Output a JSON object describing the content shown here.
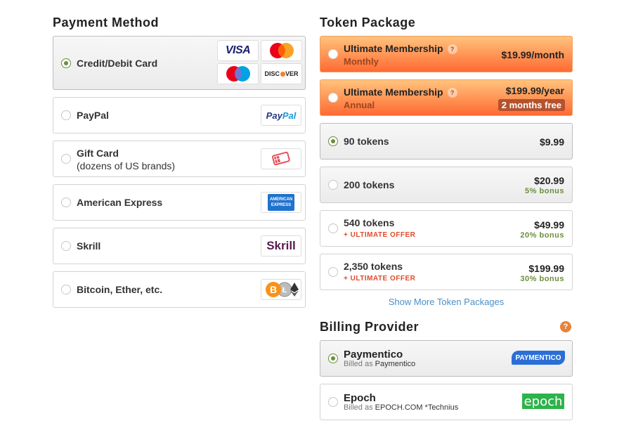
{
  "payment_method": {
    "title": "Payment Method",
    "options": [
      {
        "label": "Credit/Debit Card",
        "selected": true,
        "logos": [
          "visa-logo",
          "mastercard-logo",
          "maestro-logo",
          "discover-logo"
        ]
      },
      {
        "label": "PayPal",
        "selected": false,
        "logo_text": "PayPal"
      },
      {
        "label": "Gift Card",
        "sublabel": "(dozens of US brands)",
        "selected": false,
        "logo": "gift-card-icon"
      },
      {
        "label": "American Express",
        "selected": false,
        "logo_lines": [
          "AMERICAN",
          "EXPRESS"
        ]
      },
      {
        "label": "Skrill",
        "selected": false,
        "logo_text": "Skrill"
      },
      {
        "label": "Bitcoin, Ether, etc.",
        "selected": false,
        "logo": "crypto-icons"
      }
    ],
    "logo_text": {
      "visa": "VISA",
      "discover_a": "DISC",
      "discover_b": "VER",
      "paypal_a": "Pay",
      "paypal_b": "Pal"
    }
  },
  "token_package": {
    "title": "Token Package",
    "memberships": [
      {
        "name": "Ultimate Membership",
        "period": "Monthly",
        "price": "$19.99/month",
        "selected": false
      },
      {
        "name": "Ultimate Membership",
        "period": "Annual",
        "price": "$199.99/year",
        "badge": "2 months free",
        "selected": false
      }
    ],
    "help_glyph": "?",
    "packages": [
      {
        "name": "90 tokens",
        "price": "$9.99",
        "selected": true
      },
      {
        "name": "200 tokens",
        "price": "$20.99",
        "bonus": "5% bonus",
        "selected": false
      },
      {
        "name": "540 tokens",
        "price": "$49.99",
        "bonus": "20% bonus",
        "offer": "+ ULTIMATE OFFER",
        "selected": false
      },
      {
        "name": "2,350 tokens",
        "price": "$199.99",
        "bonus": "30% bonus",
        "offer": "+ ULTIMATE OFFER",
        "selected": false
      }
    ],
    "show_more": "Show More Token Packages"
  },
  "billing_provider": {
    "title": "Billing Provider",
    "help_glyph": "?",
    "providers": [
      {
        "name": "Paymentico",
        "billed_prefix": "Billed as",
        "billed_as": "Paymentico",
        "logo_text": "PAYMENTICO",
        "selected": true
      },
      {
        "name": "Epoch",
        "billed_prefix": "Billed as",
        "billed_as": "EPOCH.COM *Technius",
        "logo_text": "epoch",
        "selected": false
      }
    ]
  },
  "colors": {
    "selected_radio": "#6b8e3b",
    "bonus_green": "#6b8e3b",
    "offer_red": "#e04a2a",
    "link_blue": "#4a90c8",
    "membership_orange_top": "#ffc37d",
    "membership_orange_bottom": "#ff6a32"
  }
}
